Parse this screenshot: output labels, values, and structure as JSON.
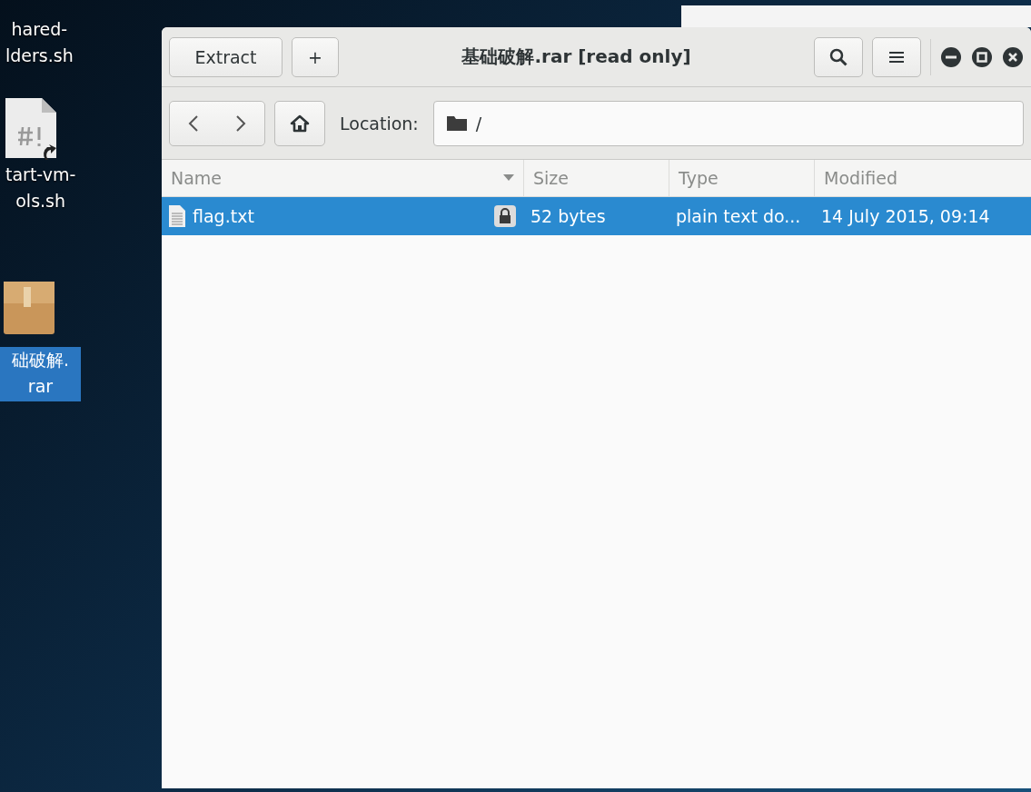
{
  "desktop": {
    "icons": [
      {
        "kind": "label",
        "label_lines": [
          "hared-",
          "lders.sh"
        ],
        "selected": false
      },
      {
        "kind": "script",
        "label_lines": [
          "tart-vm-",
          "ols.sh"
        ],
        "selected": false
      },
      {
        "kind": "archive",
        "label_lines": [
          "础破解.",
          "rar"
        ],
        "selected": true
      }
    ]
  },
  "window": {
    "title": "基础破解.rar [read only]",
    "extract_button": "Extract",
    "add_button": "+",
    "location_label": "Location:",
    "location_path": "/"
  },
  "table": {
    "columns": [
      {
        "label": "Name",
        "sorted": true
      },
      {
        "label": "Size",
        "sorted": false
      },
      {
        "label": "Type",
        "sorted": false
      },
      {
        "label": "Modified",
        "sorted": false
      }
    ],
    "rows": [
      {
        "name": "flag.txt",
        "locked": true,
        "size": "52 bytes",
        "type": "plain text do...",
        "modified": "14 July 2015, 09:14",
        "selected": true
      }
    ]
  }
}
